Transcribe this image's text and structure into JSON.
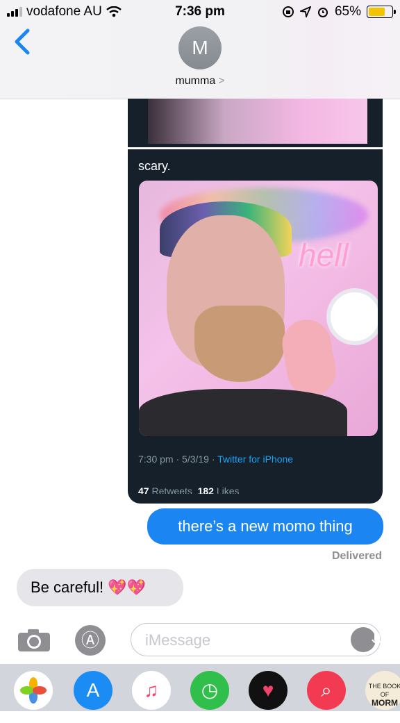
{
  "status": {
    "carrier": "vodafone AU",
    "time": "7:36 pm",
    "battery": "65%",
    "battery_level": 0.65
  },
  "header": {
    "avatar_initial": "M",
    "contact_name": "mumma",
    "chevron": ">"
  },
  "tweet": {
    "text": "scary.",
    "meta_time": "7:30 pm · 5/3/19 · ",
    "meta_source": "Twitter for iPhone",
    "retweets_count": "47",
    "retweets_label": "Retweets",
    "likes_count": "182",
    "likes_label": "Likes"
  },
  "messages": {
    "sent": "there’s a new momo thing",
    "delivered": "Delivered",
    "received": "Be careful! 💖💖"
  },
  "composer": {
    "placeholder": "iMessage"
  },
  "dock": {
    "apps": [
      "photos-app",
      "app-store-app",
      "music-app",
      "find-my-app",
      "heart-app",
      "search-app",
      "book-app"
    ],
    "book_label_top": "THE BOOK OF",
    "book_label": "MORM"
  },
  "colors": {
    "imessage_blue": "#1b86f2",
    "received_gray": "#e5e5ea",
    "tweet_bg": "#15202b",
    "twitter_link": "#1da1f2"
  }
}
